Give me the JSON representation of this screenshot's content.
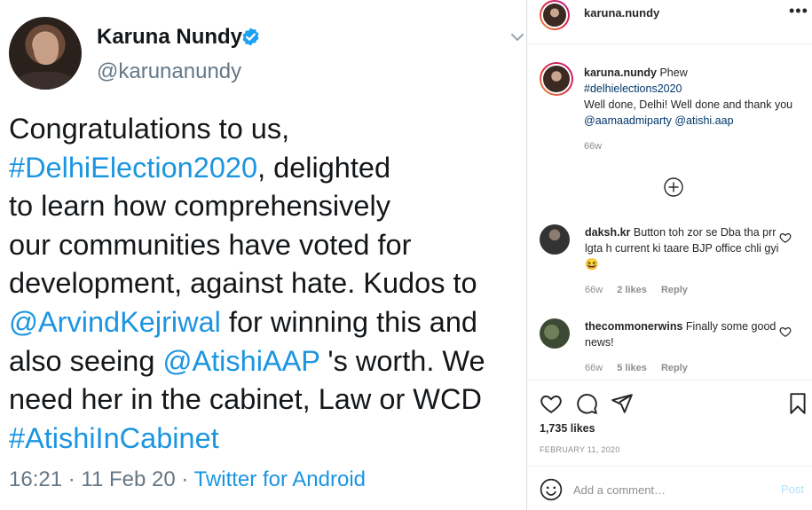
{
  "tweet": {
    "name": "Karuna Nundy",
    "handle": "@karunanundy",
    "body": {
      "l1": "Congratulations to us,",
      "l2_link": "#DelhiElection2020",
      "l2_rest": ", delighted",
      "l3": "to learn how comprehensively",
      "l4": "our communities have voted for",
      "l5": "development, against hate. Kudos to",
      "l6_link": "@ArvindKejriwal",
      "l6_rest": " for winning this and",
      "l7_pre": "also seeing ",
      "l7_link": "@AtishiAAP",
      "l7_rest": " 's worth. We",
      "l8": "need her in the cabinet, Law or WCD",
      "l9_link": "#AtishiInCabinet"
    },
    "meta": "16:21 · 11 Feb 20 · ",
    "source": "Twitter for Android",
    "link_color": "#1b95e0",
    "verified_color": "#1da1f2"
  },
  "instagram": {
    "header": {
      "username": "karuna.nundy",
      "more": "•••"
    },
    "caption": {
      "username": "karuna.nundy",
      "text1": "Phew",
      "hashtag": "#delhielections2020",
      "text2": "Well done, Delhi! Well done and thank you",
      "mention1": "@aamaadmiparty",
      "mention2": "@atishi.aap",
      "time": "66w"
    },
    "comments": [
      {
        "username": "daksh.kr",
        "text": "Button toh zor se Dba tha prr lgta h current ki taare BJP office chli gyi😆",
        "time": "66w",
        "likes": "2 likes",
        "reply": "Reply"
      },
      {
        "username": "thecommonerwins",
        "text": "Finally some good news!",
        "time": "66w",
        "likes": "5 likes",
        "reply": "Reply"
      }
    ],
    "likes": "1,735 likes",
    "date": "FEBRUARY 11, 2020",
    "add_comment_placeholder": "Add a comment…",
    "post_label": "Post",
    "link_color": "#00376b"
  }
}
